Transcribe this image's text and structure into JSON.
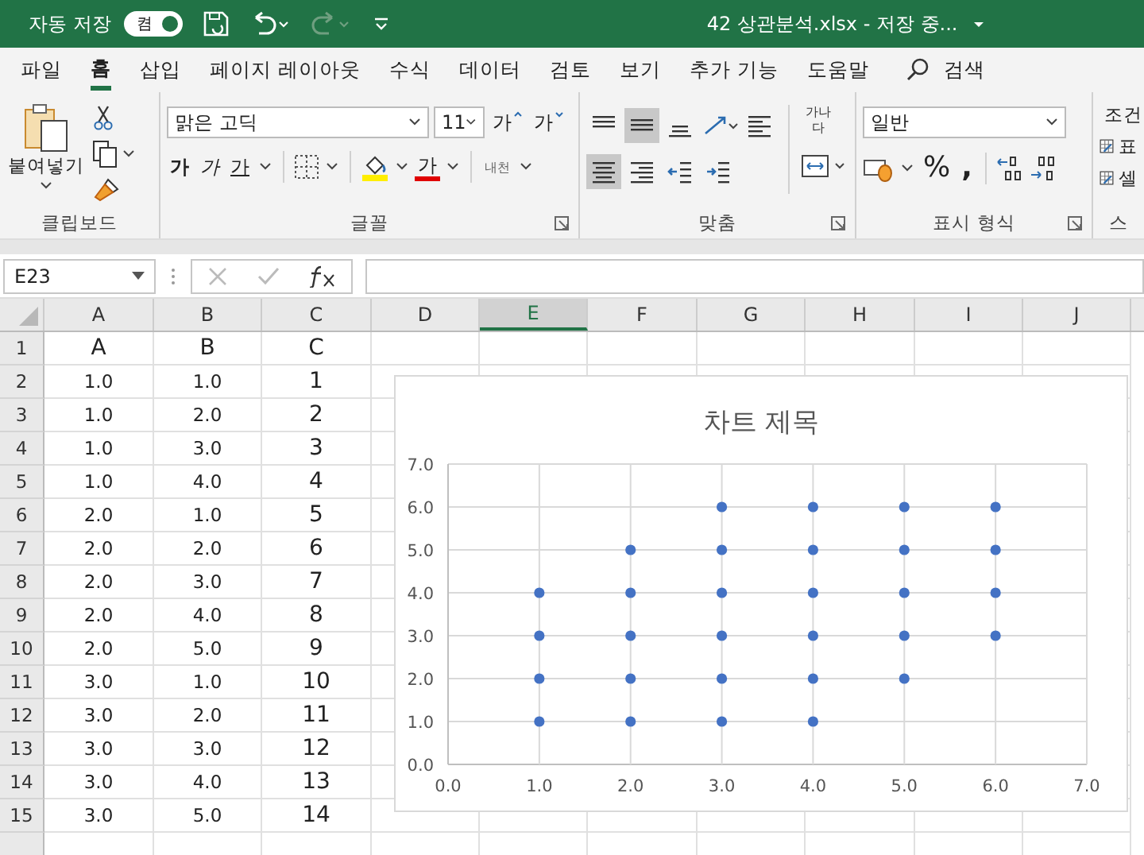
{
  "title_bar": {
    "autosave_label": "자동 저장",
    "autosave_toggle": "켬",
    "autosave_on": true,
    "file_title": "42 상관분석.xlsx  -  저장 중..."
  },
  "ribbon_tabs": [
    {
      "label": "파일",
      "selected": false
    },
    {
      "label": "홈",
      "selected": true
    },
    {
      "label": "삽입",
      "selected": false
    },
    {
      "label": "페이지 레이아웃",
      "selected": false
    },
    {
      "label": "수식",
      "selected": false
    },
    {
      "label": "데이터",
      "selected": false
    },
    {
      "label": "검토",
      "selected": false
    },
    {
      "label": "보기",
      "selected": false
    },
    {
      "label": "추가 기능",
      "selected": false
    },
    {
      "label": "도움말",
      "selected": false
    }
  ],
  "search_label": "검색",
  "clipboard": {
    "label": "클립보드",
    "paste_label": "붙여넣기"
  },
  "font": {
    "label": "글꼴",
    "font_name": "맑은 고딕",
    "font_size": "11",
    "grow": "가",
    "shrink": "가",
    "bold": "가",
    "italic": "가",
    "underline": "가",
    "font_color": "가",
    "phonetic": "내천"
  },
  "alignment": {
    "label": "맞춤",
    "wrap_label": "가나다",
    "align_buttons": [
      {
        "kind": "top",
        "pressed": false
      },
      {
        "kind": "middle",
        "pressed": true
      },
      {
        "kind": "bottom",
        "pressed": false
      },
      {
        "kind": "left",
        "pressed": false
      },
      {
        "kind": "center",
        "pressed": true
      },
      {
        "kind": "right",
        "pressed": false
      },
      {
        "kind": "outdent",
        "pressed": false
      },
      {
        "kind": "indent",
        "pressed": false
      }
    ]
  },
  "number": {
    "label": "표시 형식",
    "format": "일반",
    "percent": "%",
    "comma": ","
  },
  "styles": {
    "label": "스",
    "items": [
      "조건",
      "표",
      "셀"
    ]
  },
  "formula_bar": {
    "name_box": "E23"
  },
  "columns": [
    {
      "label": "A",
      "selected": false
    },
    {
      "label": "B",
      "selected": false
    },
    {
      "label": "C",
      "selected": false
    },
    {
      "label": "D",
      "selected": false
    },
    {
      "label": "E",
      "selected": true
    },
    {
      "label": "F",
      "selected": false
    },
    {
      "label": "G",
      "selected": false
    },
    {
      "label": "H",
      "selected": false
    },
    {
      "label": "I",
      "selected": false
    },
    {
      "label": "J",
      "selected": false
    }
  ],
  "rows": [
    {
      "number": "1",
      "cells": [
        "A",
        "B",
        "C"
      ]
    },
    {
      "number": "2",
      "cells": [
        "1.0",
        "1.0",
        "1"
      ]
    },
    {
      "number": "3",
      "cells": [
        "1.0",
        "2.0",
        "2"
      ]
    },
    {
      "number": "4",
      "cells": [
        "1.0",
        "3.0",
        "3"
      ]
    },
    {
      "number": "5",
      "cells": [
        "1.0",
        "4.0",
        "4"
      ]
    },
    {
      "number": "6",
      "cells": [
        "2.0",
        "1.0",
        "5"
      ]
    },
    {
      "number": "7",
      "cells": [
        "2.0",
        "2.0",
        "6"
      ]
    },
    {
      "number": "8",
      "cells": [
        "2.0",
        "3.0",
        "7"
      ]
    },
    {
      "number": "9",
      "cells": [
        "2.0",
        "4.0",
        "8"
      ]
    },
    {
      "number": "10",
      "cells": [
        "2.0",
        "5.0",
        "9"
      ]
    },
    {
      "number": "11",
      "cells": [
        "3.0",
        "1.0",
        "10"
      ]
    },
    {
      "number": "12",
      "cells": [
        "3.0",
        "2.0",
        "11"
      ]
    },
    {
      "number": "13",
      "cells": [
        "3.0",
        "3.0",
        "12"
      ]
    },
    {
      "number": "14",
      "cells": [
        "3.0",
        "4.0",
        "13"
      ]
    },
    {
      "number": "15",
      "cells": [
        "3.0",
        "5.0",
        "14"
      ]
    }
  ],
  "chart": {
    "chart_data": {
      "type": "scatter",
      "title": "차트 제목",
      "grid": true,
      "x": [
        1,
        1,
        1,
        1,
        2,
        2,
        2,
        2,
        2,
        3,
        3,
        3,
        3,
        3,
        3,
        4,
        4,
        4,
        4,
        4,
        4,
        5,
        5,
        5,
        5,
        5,
        6,
        6,
        6,
        6
      ],
      "series": [
        {
          "color": "#4472c4",
          "values": [
            1,
            2,
            3,
            4,
            1,
            2,
            3,
            4,
            5,
            1,
            2,
            3,
            4,
            5,
            6,
            1,
            2,
            3,
            4,
            5,
            6,
            2,
            3,
            4,
            5,
            6,
            3,
            4,
            5,
            6
          ]
        }
      ],
      "xlim": [
        0,
        7
      ],
      "ylim": [
        0,
        7
      ],
      "xticks": [
        {
          "value": 0,
          "label": "0.0"
        },
        {
          "value": 1,
          "label": "1.0"
        },
        {
          "value": 2,
          "label": "2.0"
        },
        {
          "value": 3,
          "label": "3.0"
        },
        {
          "value": 4,
          "label": "4.0"
        },
        {
          "value": 5,
          "label": "5.0"
        },
        {
          "value": 6,
          "label": "6.0"
        },
        {
          "value": 7,
          "label": "7.0"
        }
      ],
      "yticks": [
        {
          "value": 0,
          "label": "0.0"
        },
        {
          "value": 1,
          "label": "1.0"
        },
        {
          "value": 2,
          "label": "2.0"
        },
        {
          "value": 3,
          "label": "3.0"
        },
        {
          "value": 4,
          "label": "4.0"
        },
        {
          "value": 5,
          "label": "5.0"
        },
        {
          "value": 6,
          "label": "6.0"
        },
        {
          "value": 7,
          "label": "7.0"
        }
      ]
    }
  }
}
